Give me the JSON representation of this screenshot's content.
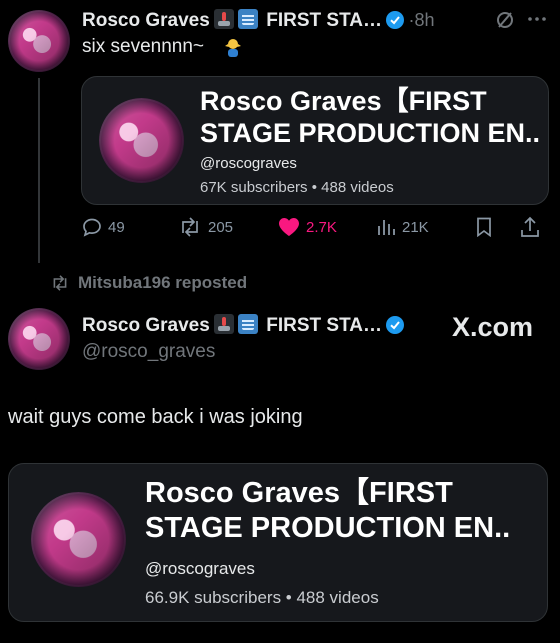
{
  "post1": {
    "author_name": "Rosco Graves",
    "affiliation": "FIRST STA…",
    "dot": "·",
    "time": "8h",
    "text": "six sevennnn~",
    "card": {
      "title_line1": "Rosco Graves【FIRST",
      "title_line2": "STAGE PRODUCTION EN..",
      "handle": "@roscograves",
      "meta": "67K subscribers • 488 videos"
    },
    "actions": {
      "replies": "49",
      "reposts": "205",
      "likes": "2.7K",
      "views": "21K"
    },
    "like_color": "#f91880"
  },
  "repost_label": "Mitsuba196 reposted",
  "post2": {
    "author_name": "Rosco Graves",
    "affiliation": "FIRST STA…",
    "handle": "@rosco_graves",
    "watermark": "X.com",
    "text": "wait guys come back i was joking",
    "card": {
      "title_line1": "Rosco Graves【FIRST",
      "title_line2": "STAGE PRODUCTION EN..",
      "handle": "@roscograves",
      "meta": "66.9K subscribers • 488 videos"
    }
  },
  "icons": [
    "joystick-emoji-icon",
    "xray-emoji-icon",
    "verified-icon",
    "grok-icon",
    "more-icon",
    "shrug-emoji-icon",
    "reply-icon",
    "repost-icon",
    "like-icon",
    "views-icon",
    "bookmark-icon",
    "share-icon"
  ],
  "colors": {
    "background": "#000000",
    "text": "#e7e9ea",
    "muted": "#71767b",
    "verified": "#1d9bf0",
    "card_bg": "#16181c"
  }
}
